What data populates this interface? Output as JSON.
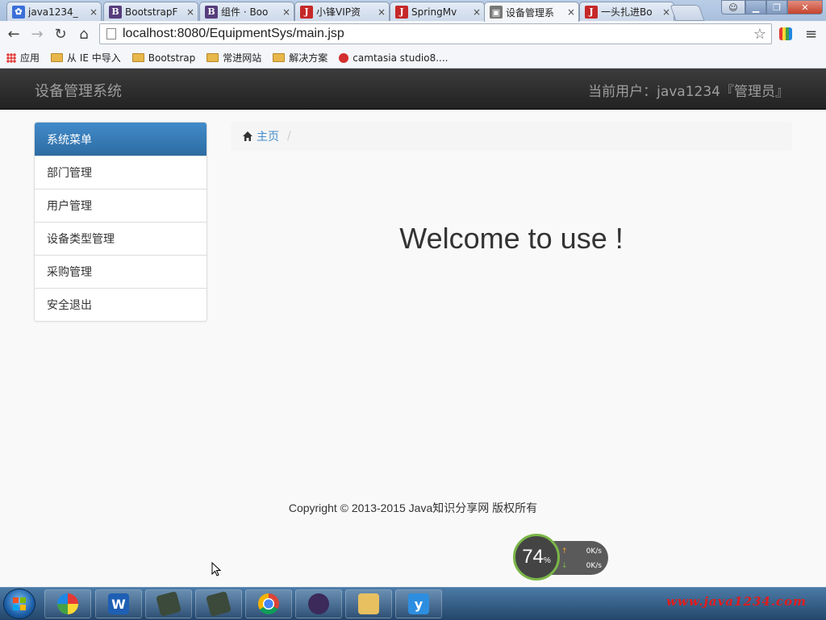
{
  "browser": {
    "tabs": [
      {
        "label": "java1234_",
        "favicon": "paw-icon",
        "color": "#3a6fd8",
        "active": false
      },
      {
        "label": "BootstrapF",
        "favicon": "bootstrap-icon",
        "color": "#563d7c",
        "active": false
      },
      {
        "label": "组件 · Boo",
        "favicon": "bootstrap-icon",
        "color": "#563d7c",
        "active": false
      },
      {
        "label": "小锋VIP资",
        "favicon": "j-icon",
        "color": "#c62828",
        "active": false
      },
      {
        "label": "SpringMv",
        "favicon": "j-icon",
        "color": "#c62828",
        "active": false
      },
      {
        "label": "设备管理系",
        "favicon": "page-icon",
        "color": "#777777",
        "active": true
      },
      {
        "label": "一头扎进Bo",
        "favicon": "j-icon",
        "color": "#c62828",
        "active": false
      }
    ],
    "tab_close": "×",
    "address": "localhost:8080/EquipmentSys/main.jsp",
    "bookmarks": [
      {
        "label": "应用",
        "icon": "apps-icon"
      },
      {
        "label": "从 IE 中导入",
        "icon": "folder-icon"
      },
      {
        "label": "Bootstrap",
        "icon": "folder-icon"
      },
      {
        "label": "常进网站",
        "icon": "folder-icon"
      },
      {
        "label": "解决方案",
        "icon": "folder-icon"
      },
      {
        "label": "camtasia studio8....",
        "icon": "camtasia-icon"
      }
    ]
  },
  "app": {
    "brand": "设备管理系统",
    "current_user": "当前用户：java1234『管理员』",
    "menu_title": "系统菜单",
    "menu_items": [
      "部门管理",
      "用户管理",
      "设备类型管理",
      "采购管理",
      "安全退出"
    ],
    "breadcrumb_home": "主页",
    "breadcrumb_sep": "/",
    "welcome": "Welcome to use !",
    "footer": "Copyright © 2013-2015 Java知识分享网 版权所有"
  },
  "speed_widget": {
    "percent": "74",
    "percent_sign": "%",
    "up": "0",
    "down": "0",
    "unit": "K/s"
  },
  "taskbar": {
    "watermark": "www.java1234.com"
  },
  "colors": {
    "primary": "#428bca",
    "navbar": "#222222",
    "brand_text": "#9d9d9d"
  }
}
